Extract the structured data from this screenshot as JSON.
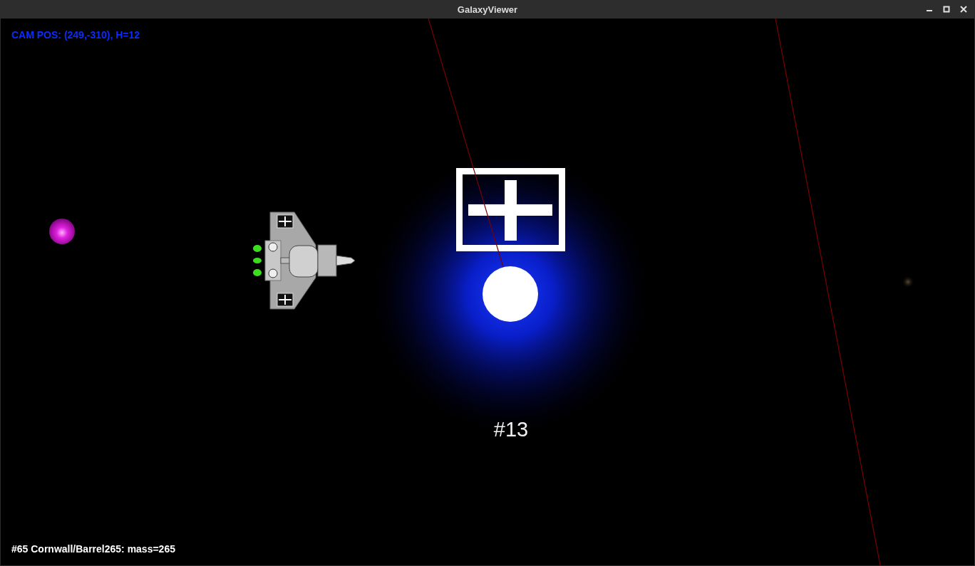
{
  "window": {
    "title": "GalaxyViewer"
  },
  "hud": {
    "camera_position": "CAM POS: (249,-310), H=12"
  },
  "star": {
    "label": "#13"
  },
  "status_bar": {
    "text": "#65 Cornwall/Barrel265: mass=265"
  }
}
